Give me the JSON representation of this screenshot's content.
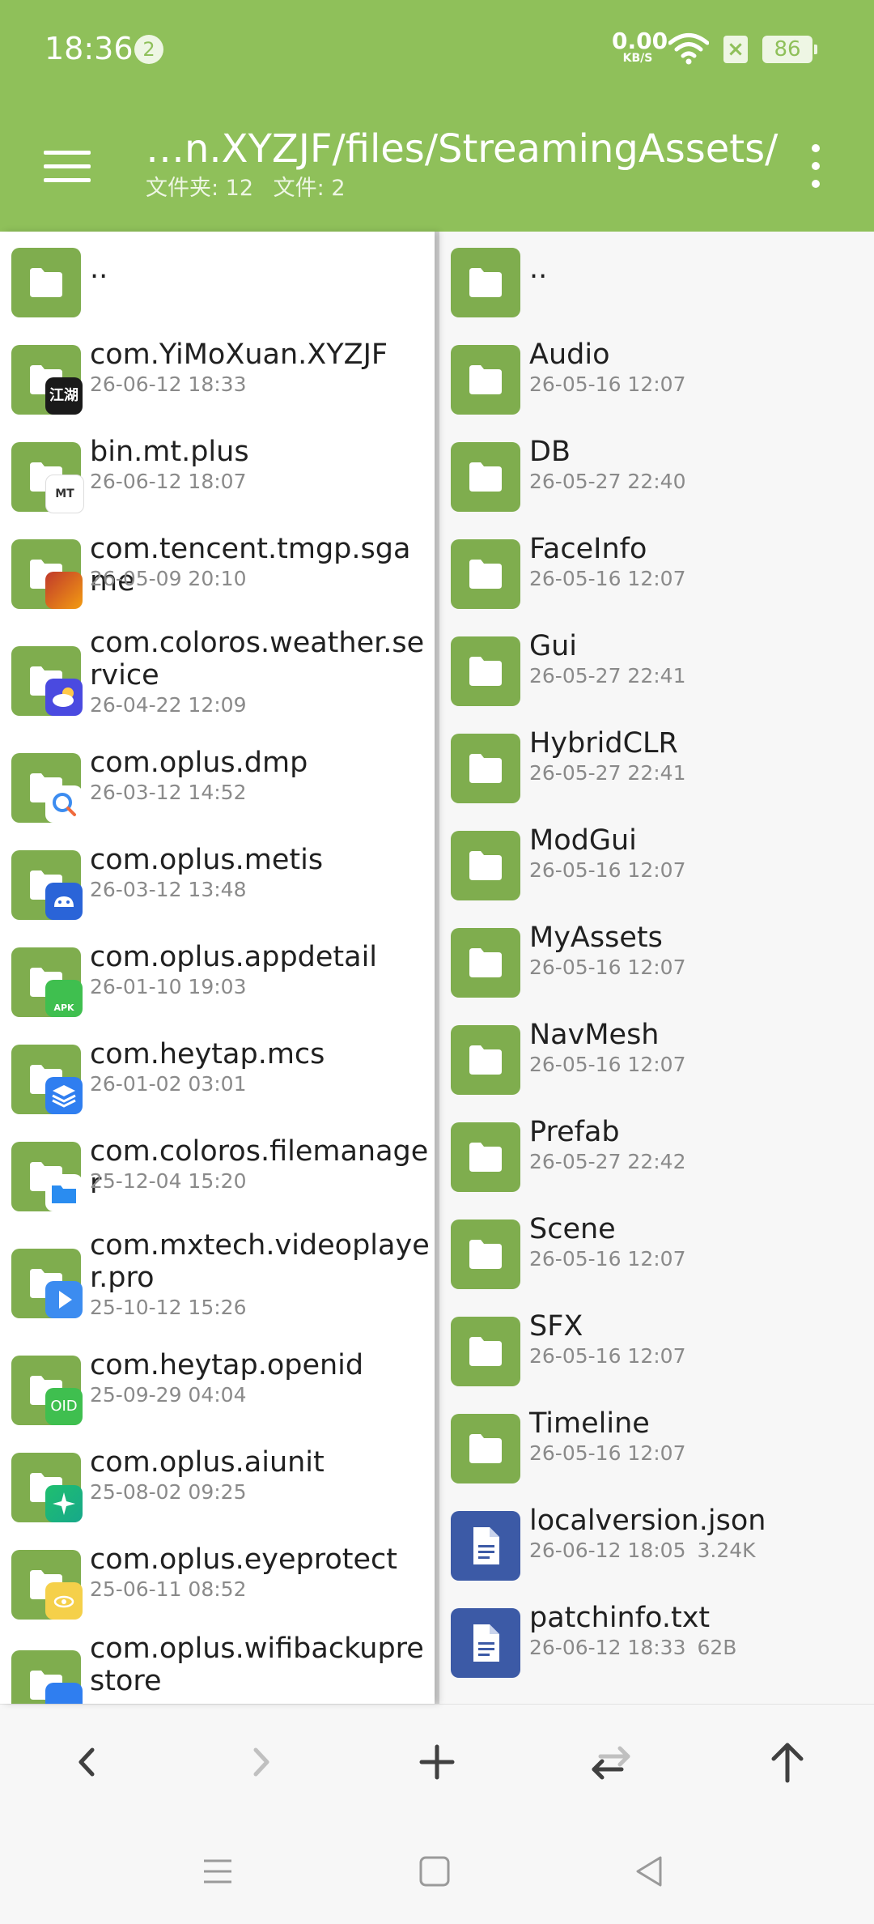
{
  "status": {
    "time": "18:36",
    "notification_count": "2",
    "net_speed_value": "0.00",
    "net_speed_unit": "KB/S",
    "battery": "86"
  },
  "header": {
    "path": "…n.XYZJF/files/StreamingAssets/",
    "folders_label": "文件夹: 12",
    "files_label": "文件: 2"
  },
  "left_pane": {
    "items": [
      {
        "name": "..",
        "date": ""
      },
      {
        "name": "com.YiMoXuan.XYZJF",
        "date": "26-06-12 18:33",
        "badge": "江湖"
      },
      {
        "name": "bin.mt.plus",
        "date": "26-06-12 18:07",
        "badge": "MT"
      },
      {
        "name": "com.tencent.tmgp.sgame",
        "date": "26-05-09 20:10",
        "badge": ""
      },
      {
        "name": "com.coloros.weather.service",
        "date": "26-04-22 12:09",
        "badge": ""
      },
      {
        "name": "com.oplus.dmp",
        "date": "26-03-12 14:52",
        "badge": ""
      },
      {
        "name": "com.oplus.metis",
        "date": "26-03-12 13:48",
        "badge": ""
      },
      {
        "name": "com.oplus.appdetail",
        "date": "26-01-10 19:03",
        "badge": "APK"
      },
      {
        "name": "com.heytap.mcs",
        "date": "26-01-02 03:01",
        "badge": ""
      },
      {
        "name": "com.coloros.filemanager",
        "date": "25-12-04 15:20",
        "badge": ""
      },
      {
        "name": "com.mxtech.videoplayer.pro",
        "date": "25-10-12 15:26",
        "badge": ""
      },
      {
        "name": "com.heytap.openid",
        "date": "25-09-29 04:04",
        "badge": "OID"
      },
      {
        "name": "com.oplus.aiunit",
        "date": "25-08-02 09:25",
        "badge": ""
      },
      {
        "name": "com.oplus.eyeprotect",
        "date": "25-06-11 08:52",
        "badge": ""
      },
      {
        "name": "com.oplus.wifibackuprestore",
        "date": "",
        "badge": ""
      }
    ]
  },
  "right_pane": {
    "items": [
      {
        "name": "..",
        "date": "",
        "size": ""
      },
      {
        "name": "Audio",
        "date": "26-05-16 12:07",
        "size": ""
      },
      {
        "name": "DB",
        "date": "26-05-27 22:40",
        "size": ""
      },
      {
        "name": "FaceInfo",
        "date": "26-05-16 12:07",
        "size": ""
      },
      {
        "name": "Gui",
        "date": "26-05-27 22:41",
        "size": ""
      },
      {
        "name": "HybridCLR",
        "date": "26-05-27 22:41",
        "size": ""
      },
      {
        "name": "ModGui",
        "date": "26-05-16 12:07",
        "size": ""
      },
      {
        "name": "MyAssets",
        "date": "26-05-16 12:07",
        "size": ""
      },
      {
        "name": "NavMesh",
        "date": "26-05-16 12:07",
        "size": ""
      },
      {
        "name": "Prefab",
        "date": "26-05-27 22:42",
        "size": ""
      },
      {
        "name": "Scene",
        "date": "26-05-16 12:07",
        "size": ""
      },
      {
        "name": "SFX",
        "date": "26-05-16 12:07",
        "size": ""
      },
      {
        "name": "Timeline",
        "date": "26-05-16 12:07",
        "size": ""
      },
      {
        "name": "localversion.json",
        "date": "26-06-12 18:05",
        "size": "3.24K"
      },
      {
        "name": "patchinfo.txt",
        "date": "26-06-12 18:33",
        "size": "62B"
      }
    ]
  },
  "colors": {
    "accent": "#8fc05a",
    "folder": "#7fad4e",
    "document": "#3c5aa6"
  },
  "icons": {
    "toolbar": [
      "back-icon",
      "forward-icon",
      "add-icon",
      "swap-icon",
      "up-icon"
    ],
    "navbar": [
      "recents-icon",
      "home-icon",
      "back-triangle-icon"
    ]
  }
}
